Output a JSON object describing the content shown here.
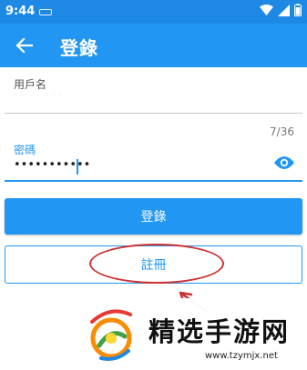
{
  "status_bar": {
    "time": "9:44"
  },
  "app_bar": {
    "title": "登錄"
  },
  "form": {
    "username_label": "用戶名",
    "password_label": "密碼",
    "password_value": "•••••••••••",
    "counter": "7/36"
  },
  "buttons": {
    "login": "登錄",
    "register": "註冊"
  },
  "watermark": {
    "text": "精选手游网",
    "url": "www.tzymjx.net"
  },
  "colors": {
    "primary": "#2196f3",
    "status_bar": "#1e88e5",
    "annotation": "#cc3333"
  },
  "icons": [
    "back-arrow-icon",
    "wifi-icon",
    "signal-icon",
    "battery-icon",
    "eye-icon"
  ]
}
